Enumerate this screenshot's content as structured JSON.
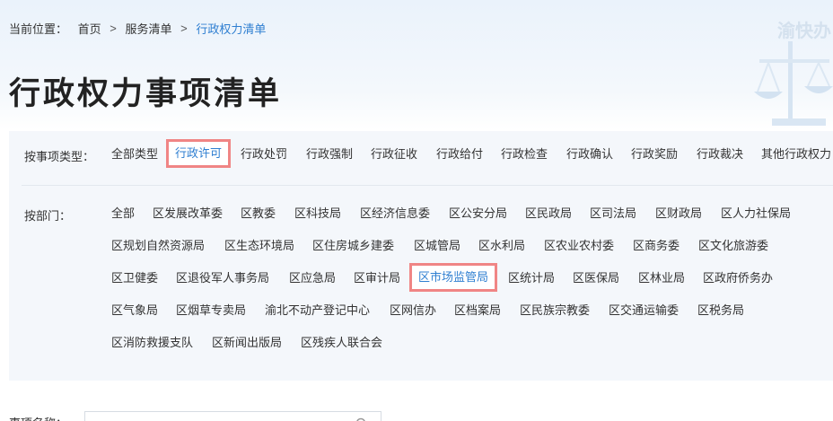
{
  "breadcrumb": {
    "lead": "当前位置：",
    "home": "首页",
    "services": "服务清单",
    "current": "行政权力清单",
    "separator": ">"
  },
  "watermark": "渝快办",
  "page_title": "行政权力事项清单",
  "type_filter": {
    "label": "按事项类型：",
    "options": [
      "全部类型",
      "行政许可",
      "行政处罚",
      "行政强制",
      "行政征收",
      "行政给付",
      "行政检查",
      "行政确认",
      "行政奖励",
      "行政裁决",
      "其他行政权力"
    ],
    "selected": "行政许可"
  },
  "dept_filter": {
    "label": "按部门：",
    "options": [
      "全部",
      "区发展改革委",
      "区教委",
      "区科技局",
      "区经济信息委",
      "区公安分局",
      "区民政局",
      "区司法局",
      "区财政局",
      "区人力社保局",
      "区规划自然资源局",
      "区生态环境局",
      "区住房城乡建委",
      "区城管局",
      "区水利局",
      "区农业农村委",
      "区商务委",
      "区文化旅游委",
      "区卫健委",
      "区退役军人事务局",
      "区应急局",
      "区审计局",
      "区市场监管局",
      "区统计局",
      "区医保局",
      "区林业局",
      "区政府侨务办",
      "区气象局",
      "区烟草专卖局",
      "渝北不动产登记中心",
      "区网信办",
      "区档案局",
      "区民族宗教委",
      "区交通运输委",
      "区税务局",
      "区消防救援支队",
      "区新闻出版局",
      "区残疾人联合会"
    ],
    "selected": "区市场监管局"
  },
  "search": {
    "label": "事项名称：",
    "value": "",
    "placeholder": ""
  },
  "colors": {
    "accent": "#2f7fd1",
    "highlight_border": "#f08585"
  }
}
